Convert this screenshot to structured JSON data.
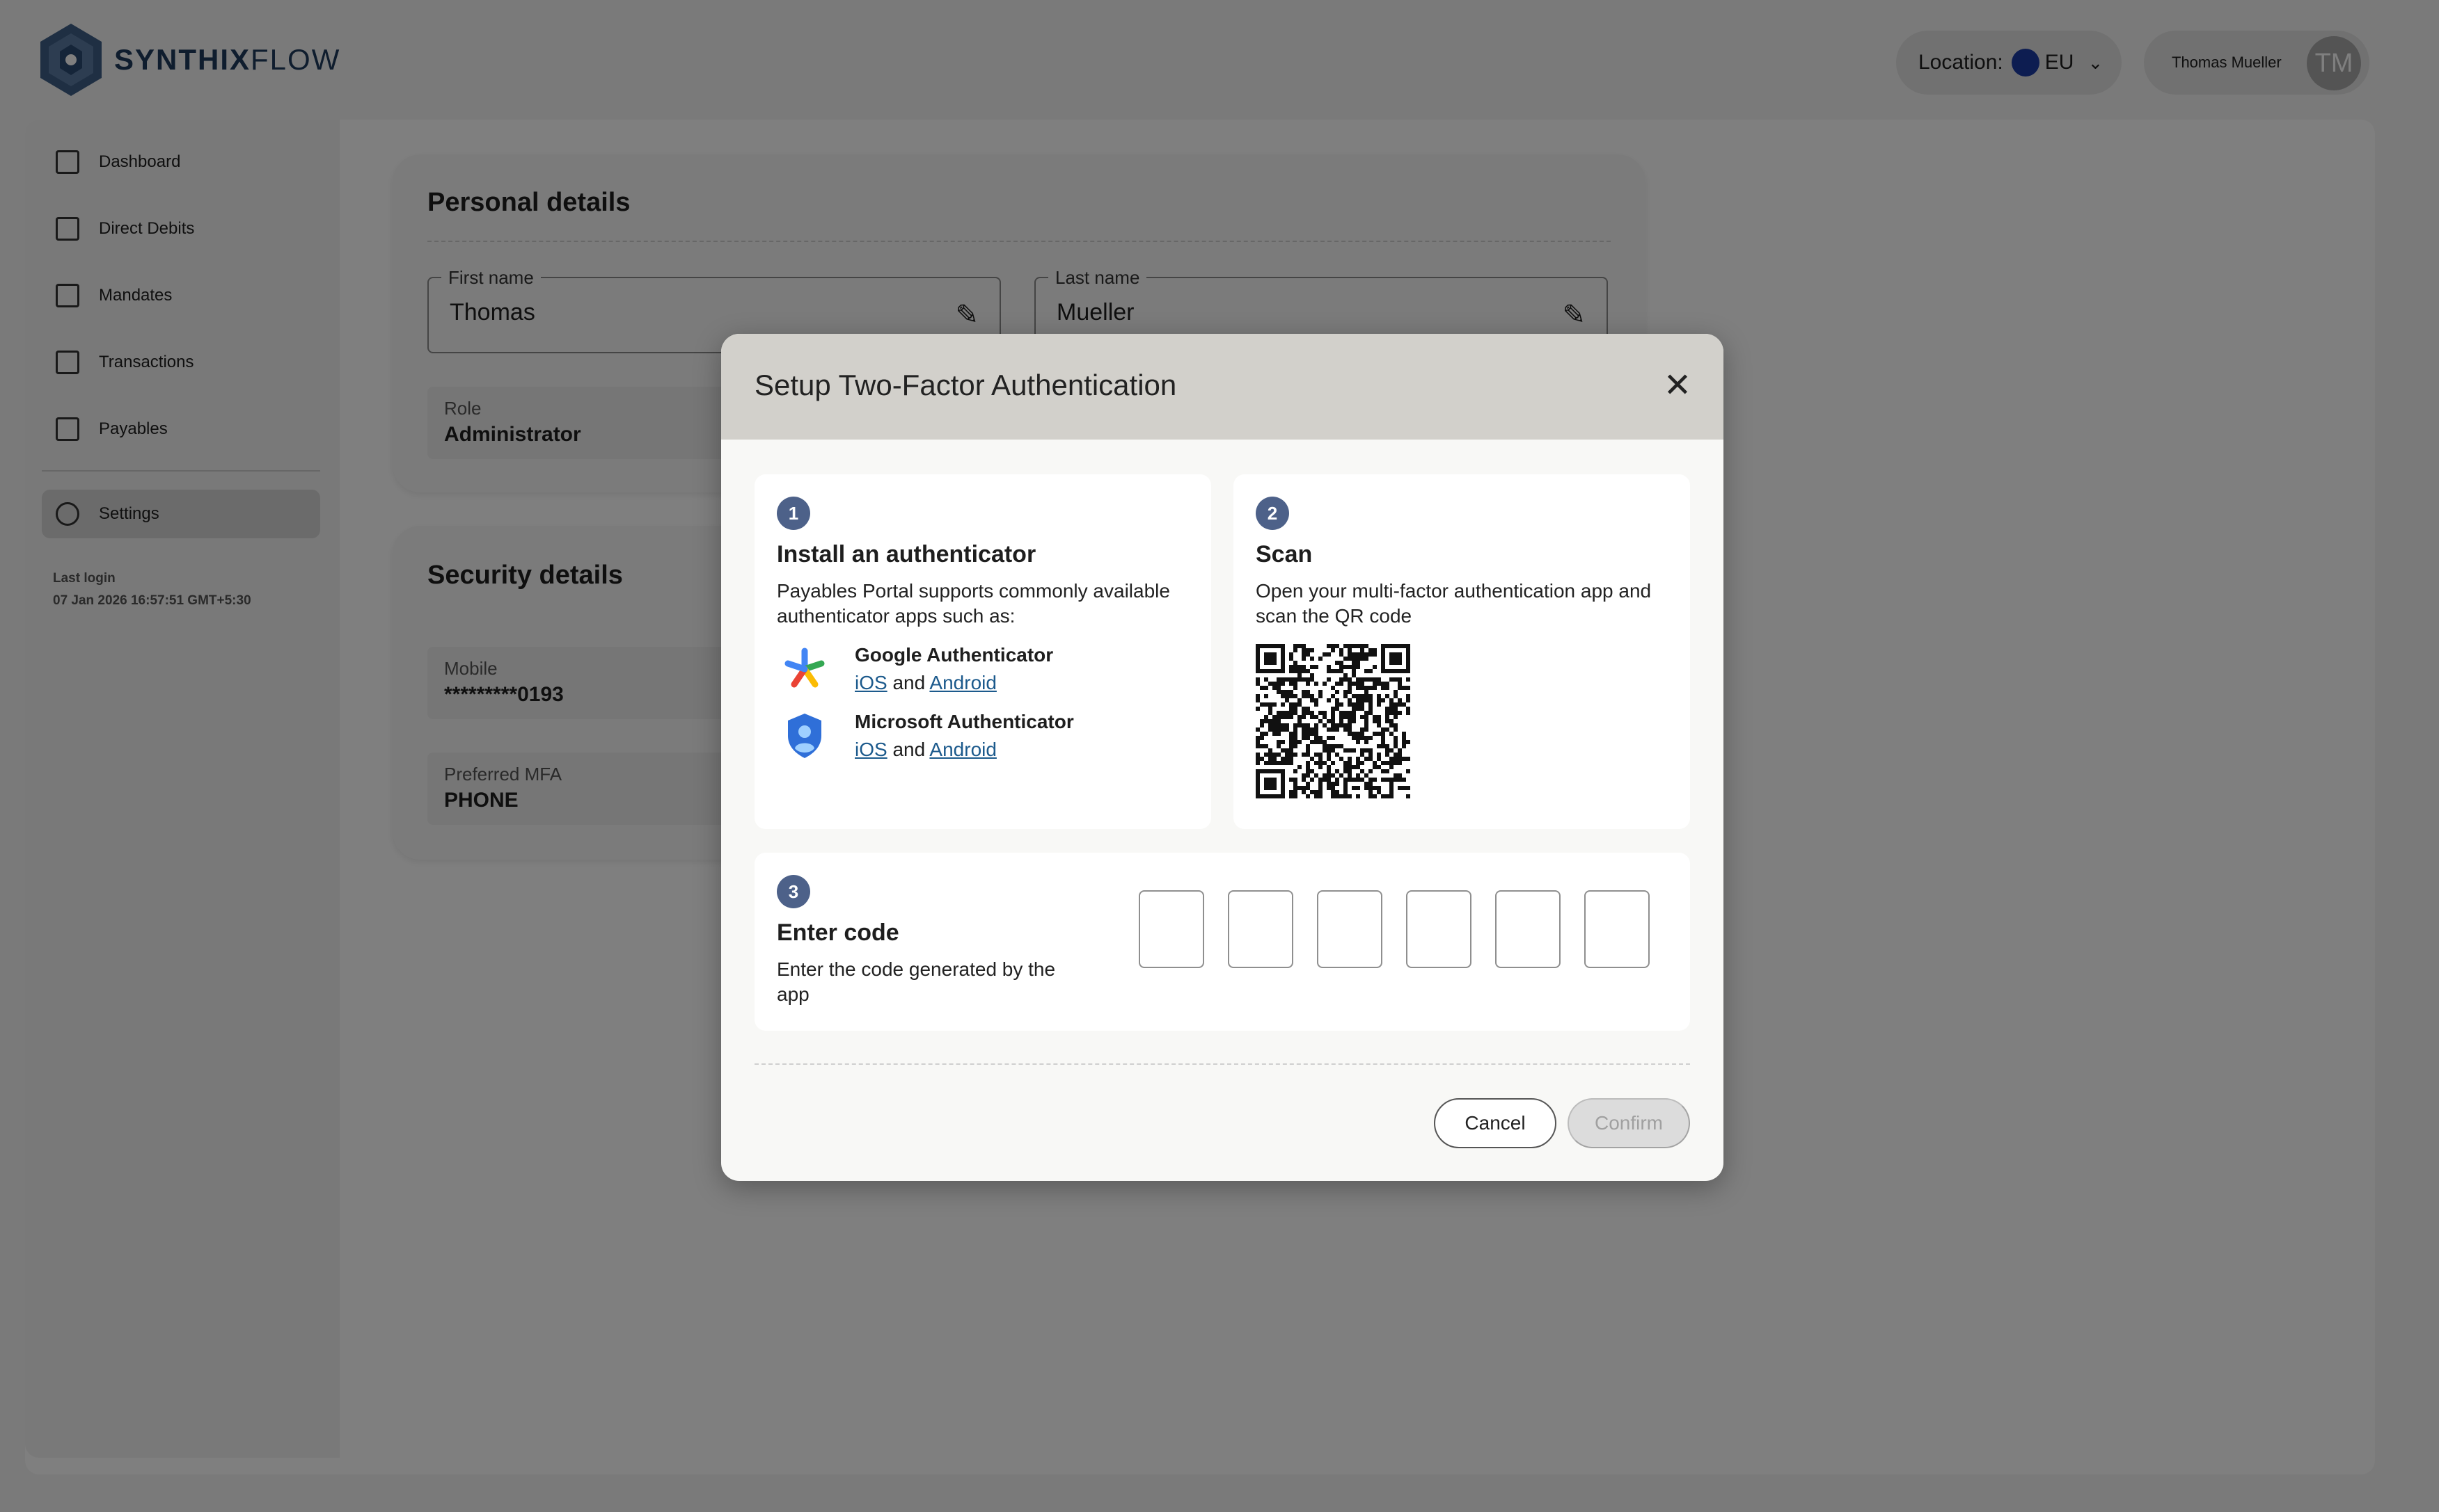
{
  "brand": {
    "name_bold": "SYNTHIX",
    "name_light": "FLOW"
  },
  "header": {
    "location_label": "Location:",
    "location_value": "EU",
    "user_name": "Thomas Mueller",
    "user_initials": "TM"
  },
  "sidebar": {
    "items": [
      {
        "label": "Dashboard",
        "icon": "dashboard-icon"
      },
      {
        "label": "Direct Debits",
        "icon": "direct-debits-icon"
      },
      {
        "label": "Mandates",
        "icon": "calendar-icon"
      },
      {
        "label": "Transactions",
        "icon": "transactions-icon"
      },
      {
        "label": "Payables",
        "icon": "payables-icon"
      },
      {
        "label": "Settings",
        "icon": "gear-icon",
        "active": true
      }
    ],
    "last_login_label": "Last login",
    "last_login_value": "07 Jan 2026 16:57:51 GMT+5:30"
  },
  "personal": {
    "title": "Personal details",
    "first_name_label": "First name",
    "first_name": "Thomas",
    "last_name_label": "Last name",
    "last_name": "Mueller",
    "role_label": "Role",
    "role": "Administrator"
  },
  "security": {
    "title": "Security details",
    "mobile_label": "Mobile",
    "mobile": "*********0193",
    "mfa_label": "Preferred MFA",
    "mfa": "PHONE"
  },
  "modal": {
    "title": "Setup Two-Factor Authentication",
    "step1": {
      "num": "1",
      "heading": "Install an authenticator",
      "text": "Payables Portal supports commonly available authenticator apps such as:",
      "apps": [
        {
          "name": "Google Authenticator",
          "ios": "iOS",
          "and": "and",
          "android": "Android",
          "icon": "google-authenticator-icon"
        },
        {
          "name": "Microsoft Authenticator",
          "ios": "iOS",
          "and": "and",
          "android": "Android",
          "icon": "microsoft-authenticator-icon"
        }
      ]
    },
    "step2": {
      "num": "2",
      "heading": "Scan",
      "text": "Open your multi-factor authentication app and scan the QR code"
    },
    "step3": {
      "num": "3",
      "heading": "Enter code",
      "text": "Enter the code generated by the app",
      "code_values": [
        "",
        "",
        "",
        "",
        "",
        ""
      ]
    },
    "cancel_label": "Cancel",
    "confirm_label": "Confirm"
  },
  "colors": {
    "step_badge": "#4d6189",
    "link": "#1c5a8c",
    "modal_header": "#d2d0cb",
    "brand": "#1f3a5c"
  }
}
